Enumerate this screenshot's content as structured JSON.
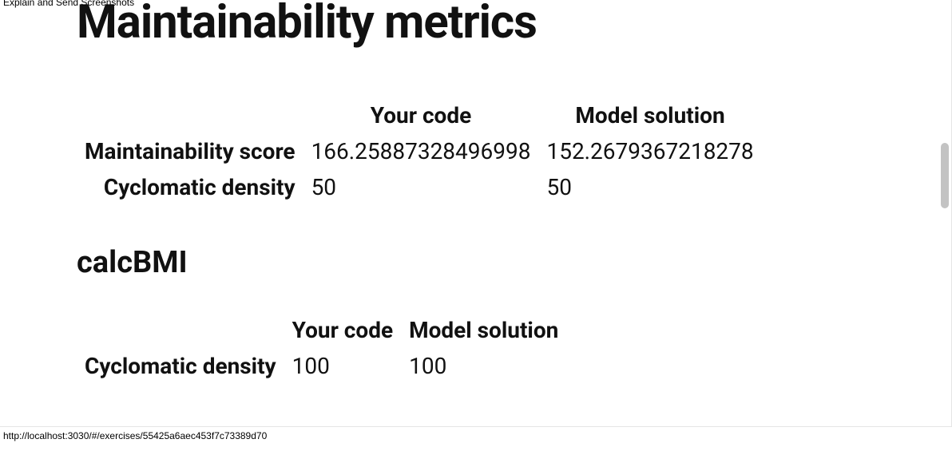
{
  "extension_label": "Explain and Send Screenshots",
  "page_title": "Maintainability metrics",
  "main_table": {
    "col_your_code": "Your code",
    "col_model_solution": "Model solution",
    "rows": [
      {
        "label": "Maintainability score",
        "your_code": "166.25887328496998",
        "model_solution": "152.2679367218278"
      },
      {
        "label": "Cyclomatic density",
        "your_code": "50",
        "model_solution": "50"
      }
    ]
  },
  "section": {
    "title": "calcBMI",
    "table": {
      "col_your_code": "Your code",
      "col_model_solution": "Model solution",
      "rows": [
        {
          "label": "Cyclomatic density",
          "your_code": "100",
          "model_solution": "100"
        }
      ]
    }
  },
  "status_url": "http://localhost:3030/#/exercises/55425a6aec453f7c73389d70"
}
